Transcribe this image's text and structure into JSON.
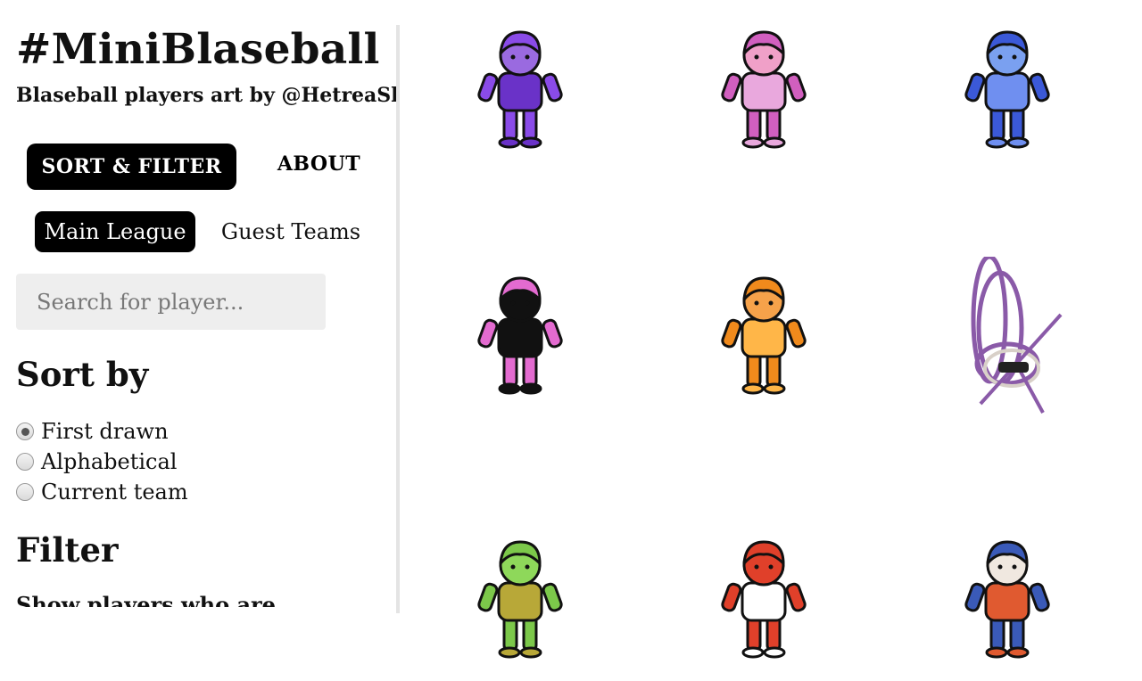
{
  "site": {
    "title": "#MiniBlaseball",
    "subtitle": "Blaseball players art by @HetreaSky"
  },
  "tabs": [
    {
      "label": "SORT & FILTER",
      "active": true
    },
    {
      "label": "ABOUT",
      "active": false
    }
  ],
  "leagues": [
    {
      "label": "Main League",
      "active": true
    },
    {
      "label": "Guest Teams",
      "active": false
    }
  ],
  "search": {
    "placeholder": "Search for player...",
    "value": ""
  },
  "sort": {
    "heading": "Sort by",
    "options": [
      {
        "label": "First drawn",
        "checked": true
      },
      {
        "label": "Alphabetical",
        "checked": false
      },
      {
        "label": "Current team",
        "checked": false
      }
    ]
  },
  "filter": {
    "heading": "Filter",
    "subheading": "Show players who are"
  },
  "gallery": {
    "players": [
      {
        "icon": "player-art-purple-pitcher",
        "main": "#8a4be8",
        "accent": "#6a32c8",
        "skin": "#9a6ae0"
      },
      {
        "icon": "player-art-pink-glasses",
        "main": "#d15fbf",
        "accent": "#e9a8dd",
        "skin": "#f0a0c8"
      },
      {
        "icon": "player-art-blue-bucket-hat",
        "main": "#3b59d8",
        "accent": "#6f8ff0",
        "skin": "#7aa0f0"
      },
      {
        "icon": "player-art-shadow-pink",
        "main": "#e36bd0",
        "accent": "#111111",
        "skin": "#111111"
      },
      {
        "icon": "player-art-orange-helmet",
        "main": "#f08a1c",
        "accent": "#ffb648",
        "skin": "#f6a24a"
      },
      {
        "icon": "player-art-tangled-loops",
        "main": "#8a5aa8",
        "accent": "#d8d0c8",
        "skin": "#222222"
      },
      {
        "icon": "player-art-green-curly",
        "main": "#7cc84a",
        "accent": "#b8a838",
        "skin": "#8ed85a"
      },
      {
        "icon": "player-art-red-chicken",
        "main": "#e0402a",
        "accent": "#ffffff",
        "skin": "#e0402a"
      },
      {
        "icon": "player-art-blue-tiger",
        "main": "#3a5ab8",
        "accent": "#e05a30",
        "skin": "#f0e8e0"
      }
    ]
  }
}
